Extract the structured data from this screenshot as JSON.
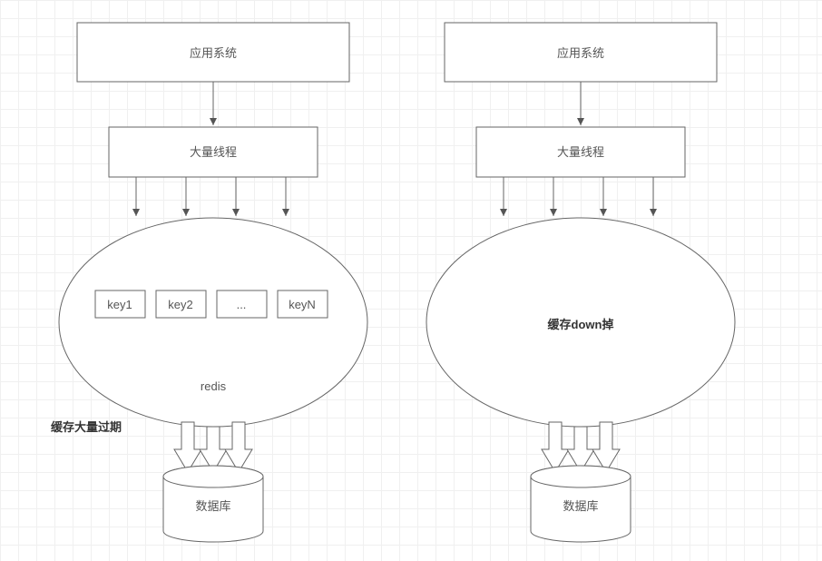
{
  "left": {
    "app_system": "应用系统",
    "threads": "大量线程",
    "redis_label": "redis",
    "keys": [
      "key1",
      "key2",
      "...",
      "keyN"
    ],
    "expire_note": "缓存大量过期",
    "database": "数据库"
  },
  "right": {
    "app_system": "应用系统",
    "threads": "大量线程",
    "cache_down": "缓存down掉",
    "database": "数据库"
  }
}
